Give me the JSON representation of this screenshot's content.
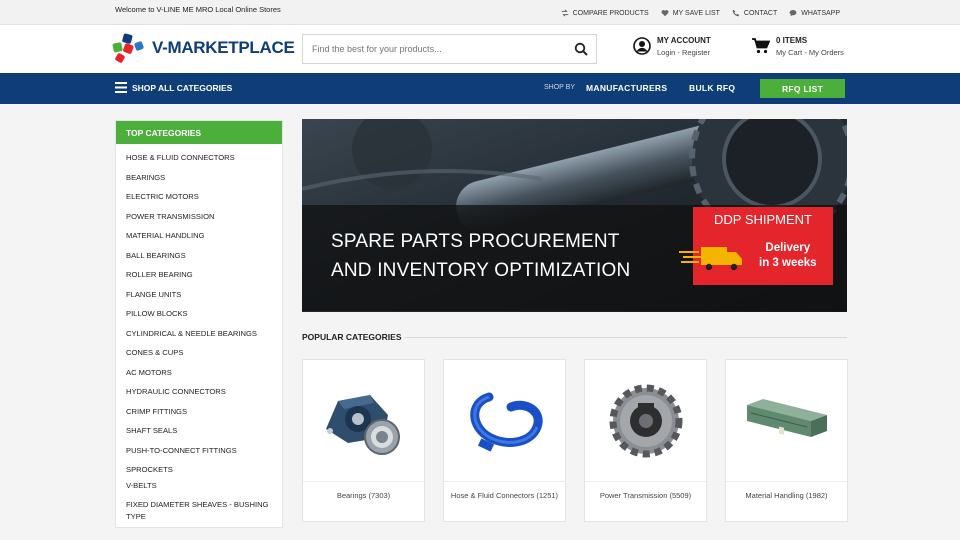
{
  "topbar": {
    "welcome": "Welcome to V-LINE ME MRO Local Online Stores",
    "links": [
      {
        "icon": "compare-icon",
        "label": "COMPARE PRODUCTS"
      },
      {
        "icon": "heart-icon",
        "label": "MY SAVE LIST"
      },
      {
        "icon": "phone-icon",
        "label": "CONTACT"
      },
      {
        "icon": "chat-icon",
        "label": "WHATSAPP"
      }
    ]
  },
  "header": {
    "logo_text": "V-MARKETPLACE",
    "search_placeholder": "Find the best for your products...",
    "account_title": "MY ACCOUNT",
    "account_sub": "Login - Register",
    "cart_title": "0 ITEMS",
    "cart_sub": "My Cart - My Orders"
  },
  "nav": {
    "all_categories": "SHOP ALL CATEGORIES",
    "shop_by": "SHOP BY",
    "manufacturers": "MANUFACTURERS",
    "bulk_rfq": "BULK RFQ",
    "rfq_list": "RFQ LIST"
  },
  "sidebar": {
    "title": "TOP CATEGORIES",
    "items": [
      "HOSE & FLUID CONNECTORS",
      "BEARINGS",
      "ELECTRIC MOTORS",
      "POWER TRANSMISSION",
      "MATERIAL HANDLING",
      "BALL BEARINGS",
      "ROLLER BEARING",
      "FLANGE UNITS",
      "PILLOW BLOCKS",
      "CYLINDRICAL & NEEDLE BEARINGS",
      "CONES & CUPS",
      "AC MOTORS",
      "HYDRAULIC CONNECTORS",
      "CRIMP FITTINGS",
      "SHAFT SEALS",
      "PUSH-TO-CONNECT FITTINGS",
      "SPROCKETS"
    ],
    "tail_items": [
      "V-BELTS",
      "FIXED DIAMETER SHEAVES - BUSHING TYPE"
    ]
  },
  "banner": {
    "line1": "SPARE PARTS PROCUREMENT",
    "line2": "AND INVENTORY OPTIMIZATION",
    "badge": "DDP SHIPMENT",
    "delivery_line1": "Delivery",
    "delivery_line2": "in 3 weeks",
    "accent": "#e4262c"
  },
  "popular": {
    "title": "POPULAR CATEGORIES",
    "cards": [
      {
        "label": "Bearings (7303)",
        "icon": "pillow-block-bearing-image"
      },
      {
        "label": "Hose & Fluid Connectors (1251)",
        "icon": "blue-hose-image"
      },
      {
        "label": "Power Transmission (5509)",
        "icon": "sprocket-image"
      },
      {
        "label": "Material Handling (1982)",
        "icon": "conveyor-image"
      }
    ]
  },
  "colors": {
    "navy": "#0e3d77",
    "green": "#4caf3c",
    "red": "#e4262c"
  }
}
